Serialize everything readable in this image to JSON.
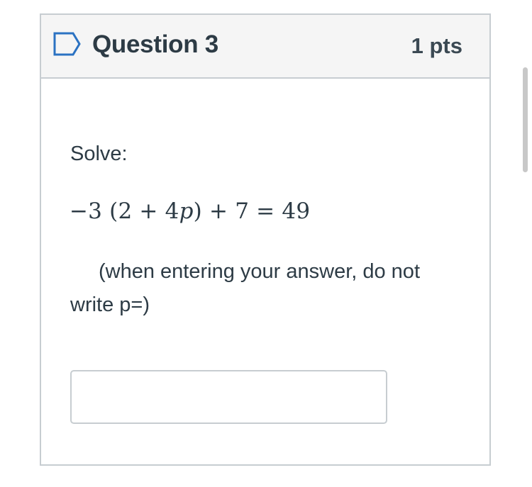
{
  "question": {
    "title": "Question 3",
    "points": "1 pts",
    "flag_icon": "flag-outline-icon"
  },
  "content": {
    "prompt": "Solve:",
    "equation": {
      "prefix": "−3 (2 + 4",
      "variable": "p",
      "suffix": ") + 7 = 49"
    },
    "note": "(when entering your answer, do not write p=)"
  },
  "answer": {
    "value": "",
    "placeholder": ""
  },
  "colors": {
    "header_bg": "#f5f5f5",
    "border": "#c7cdd1",
    "text": "#2d3b45",
    "flag_outline": "#2b72c2"
  }
}
